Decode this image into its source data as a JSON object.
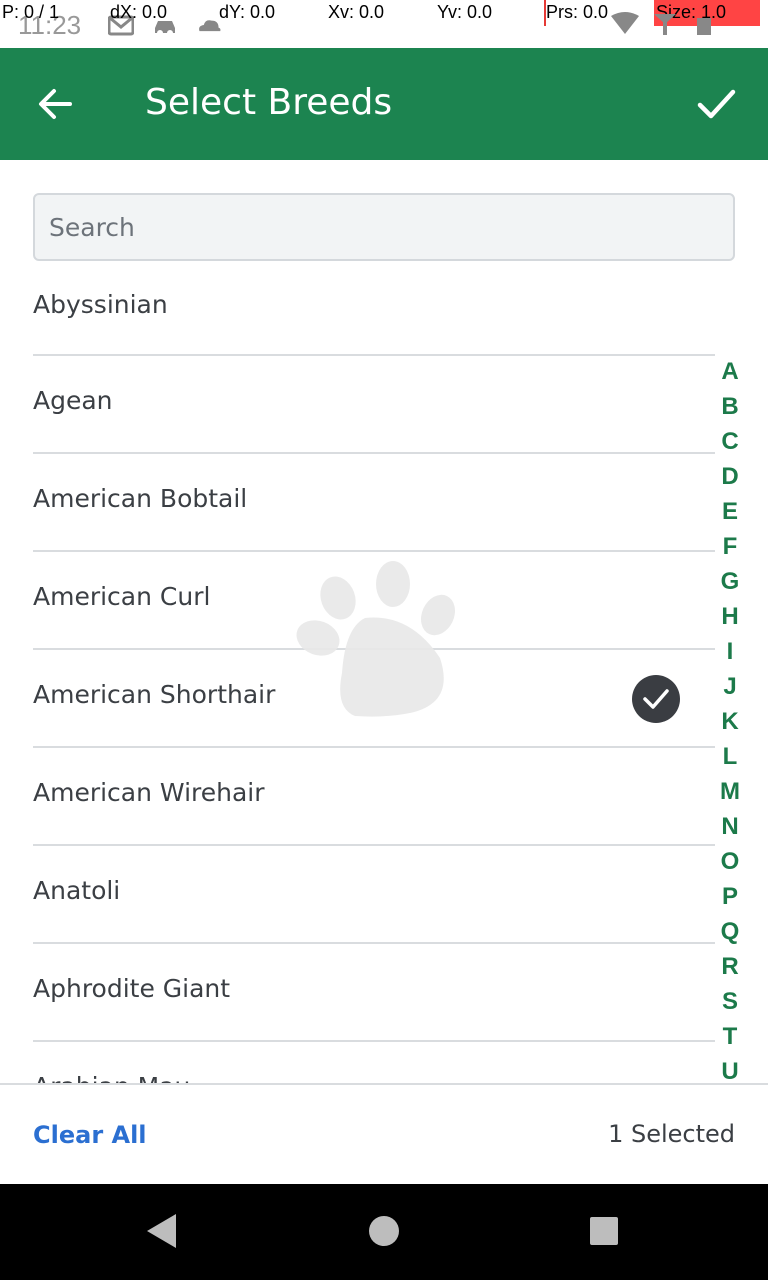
{
  "status_bar": {
    "time": "11:23",
    "debug": {
      "p": "P: 0 / 1",
      "dx": "dX: 0.0",
      "dy": "dY: 0.0",
      "xv": "Xv: 0.0",
      "yv": "Yv: 0.0",
      "prs": "Prs: 0.0",
      "size": "Size: 1.0"
    }
  },
  "app_bar": {
    "title": "Select Breeds",
    "back_icon": "arrow-left-icon",
    "confirm_icon": "check-icon"
  },
  "search": {
    "placeholder": "Search",
    "value": ""
  },
  "breeds": [
    {
      "label": "Abyssinian",
      "selected": false
    },
    {
      "label": "Agean",
      "selected": false
    },
    {
      "label": "American Bobtail",
      "selected": false
    },
    {
      "label": "American Curl",
      "selected": false
    },
    {
      "label": "American Shorthair",
      "selected": true
    },
    {
      "label": "American Wirehair",
      "selected": false
    },
    {
      "label": "Anatoli",
      "selected": false
    },
    {
      "label": "Aphrodite Giant",
      "selected": false
    },
    {
      "label": "Arabian Mau",
      "selected": false
    }
  ],
  "alpha_index": [
    "A",
    "B",
    "C",
    "D",
    "E",
    "F",
    "G",
    "H",
    "I",
    "J",
    "K",
    "L",
    "M",
    "N",
    "O",
    "P",
    "Q",
    "R",
    "S",
    "T",
    "U"
  ],
  "footer": {
    "clear_all": "Clear All",
    "selected_count": "1 Selected"
  },
  "colors": {
    "primary": "#1c8450",
    "link": "#2b6fd1",
    "index": "#1c7a4a",
    "check_badge": "#3a3d42"
  }
}
